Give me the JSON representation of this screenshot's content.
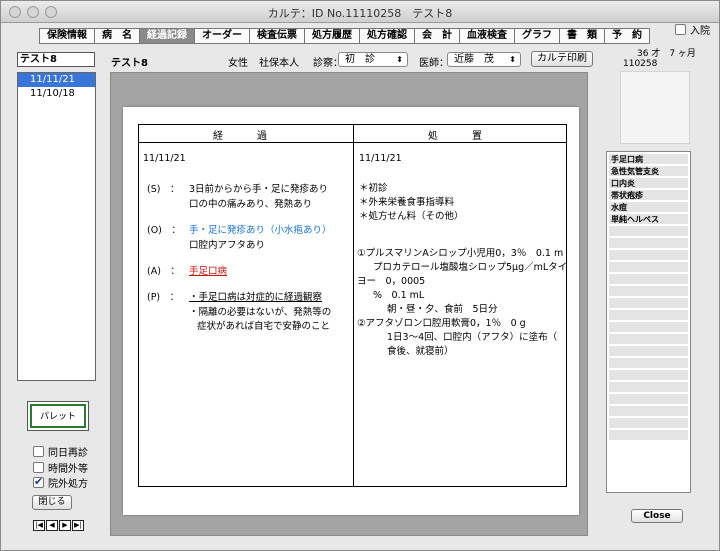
{
  "window": {
    "title": "カルテ：ID No.11110258　テスト8"
  },
  "tabs": [
    "保険情報",
    "病　名",
    "経過記録",
    "オーダー",
    "検査伝票",
    "処方履歴",
    "処方確認",
    "会　計",
    "血液検査",
    "グラフ",
    "書　類",
    "予　約"
  ],
  "active_tab": 2,
  "admission": {
    "label": "入院",
    "checked": false
  },
  "patient": {
    "name_box": "テスト8",
    "name": "テスト8",
    "sex": "女性",
    "insurance": "社保本人",
    "age": "36 才　7 ヶ月",
    "id": "110258"
  },
  "visit_dates": [
    "11/11/21",
    "11/10/18"
  ],
  "selected_date": 0,
  "header": {
    "visit_type_label": "診察：",
    "visit_type_value": "初　診",
    "doctor_label": "医師：",
    "doctor_value": "近藤　茂",
    "print_button": "カルテ印刷"
  },
  "record": {
    "col_progress": "経　過",
    "col_treatment": "処　置",
    "date": "11/11/21",
    "progress": [
      {
        "tag": "(S)　：",
        "text": "3日前からから手・足に発疹あり"
      },
      {
        "tag": "",
        "text": "口の中の痛みあり、発熱あり"
      },
      {
        "tag": "(O)　：",
        "text": "手・足に発疹あり（小水疱あり）"
      },
      {
        "tag": "",
        "text": "口腔内アフタあり"
      },
      {
        "tag": "(A)　：",
        "text": "手足口病"
      },
      {
        "tag": "(P)　：",
        "text": "・手足口病は対症的に経過観察"
      },
      {
        "tag": "",
        "text": "・隔離の必要はないが、発熱等の"
      },
      {
        "tag": "",
        "text": "症状があれば自宅で安静のこと"
      }
    ],
    "treatment_date": "11/11/21",
    "treatment": [
      "＊初診",
      "＊外来栄養食事指導料",
      "＊処方せん料（その他）",
      "①プルスマリンAシロップ小児用0，3％　0.1 m",
      "プロカテロール塩酸塩シロップ5μg／mLタイ",
      "ヨー　0，0005",
      "%　0.1 mL",
      "朝・昼・夕、食前　5日分",
      "②アフタゾロン口腔用軟膏0，1％　0 g",
      "1日3〜4回、口腔内（アフタ）に塗布（",
      "食後、就寝前）"
    ]
  },
  "diagnoses": [
    "手足口病",
    "急性気管支炎",
    "口内炎",
    "帯状疱疹",
    "水痘",
    "単純ヘルペス"
  ],
  "left_controls": {
    "palette_button": "パレット",
    "same_day_revisit": {
      "label": "同日再診",
      "checked": false
    },
    "after_hours": {
      "label": "時間外等",
      "checked": false
    },
    "outside_prescription": {
      "label": "院外処方",
      "checked": true
    },
    "close_button": "閉じる"
  },
  "close_button": "Close",
  "colors": {
    "selection": "#3875d7",
    "highlight_blue": "#1a73d8",
    "highlight_red": "#d01010",
    "palette_border": "#2a7d2a"
  }
}
